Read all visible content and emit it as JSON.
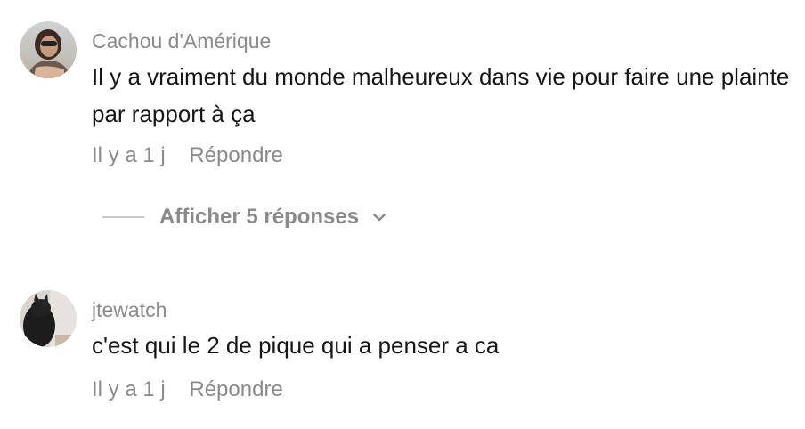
{
  "comments": [
    {
      "username": "Cachou d'Amérique",
      "avatar_icon": "user-avatar-photo-woman",
      "text": "Il y a vraiment du monde malheureux dans vie pour faire une plainte par rapport à ça",
      "time": "Il y a 1 j",
      "reply_label": "Répondre",
      "replies_toggle": "Afficher 5 réponses"
    },
    {
      "username": "jtewatch",
      "avatar_icon": "user-avatar-photo-cat",
      "text": "c'est qui le 2 de pique qui a penser a ca",
      "time": "Il y a 1 j",
      "reply_label": "Répondre"
    }
  ],
  "colors": {
    "username": "#8a8a8a",
    "text": "#161616",
    "meta": "#8a8a8a",
    "divider_line": "#c8c8c8"
  }
}
